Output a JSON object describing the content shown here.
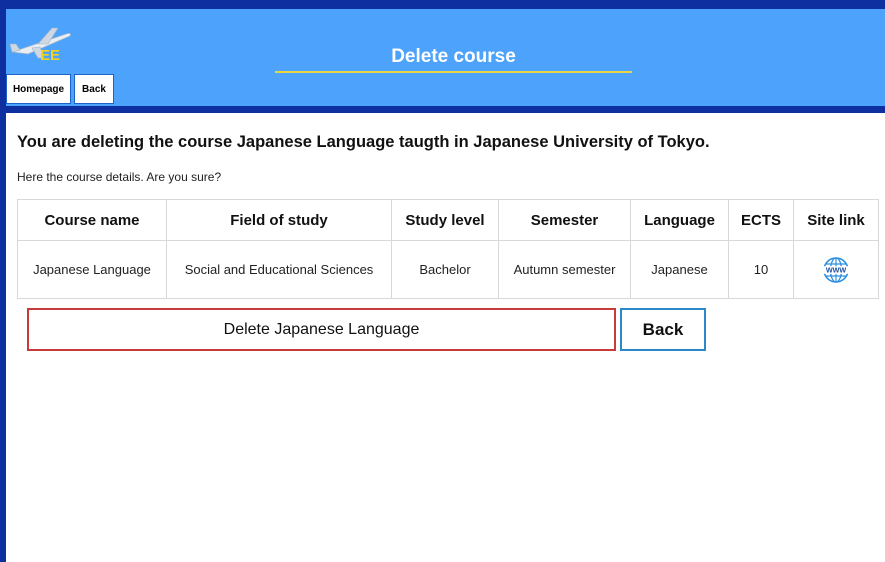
{
  "header": {
    "logo_text": "EE",
    "title": "Delete course",
    "nav": {
      "home_label": "Homepage",
      "back_label": "Back"
    }
  },
  "main": {
    "warning": "You are deleting the course Japanese Language taugth in Japanese University of Tokyo.",
    "subtitle": "Here the course details. Are you sure?",
    "table": {
      "headers": [
        "Course name",
        "Field of study",
        "Study level",
        "Semester",
        "Language",
        "ECTS",
        "Site link"
      ],
      "rows": [
        [
          "Japanese Language",
          "Social and Educational Sciences",
          "Bachelor",
          "Autumn semester",
          "Japanese",
          "10",
          "www-globe-icon"
        ]
      ]
    },
    "delete_label": "Delete Japanese Language",
    "back_label": "Back"
  },
  "colors": {
    "frame": "#0d2fa0",
    "header_bg": "#4da3fb",
    "title_underline": "#e9d543",
    "delete_border": "#c93a3a",
    "back_border": "#2c88c8"
  }
}
